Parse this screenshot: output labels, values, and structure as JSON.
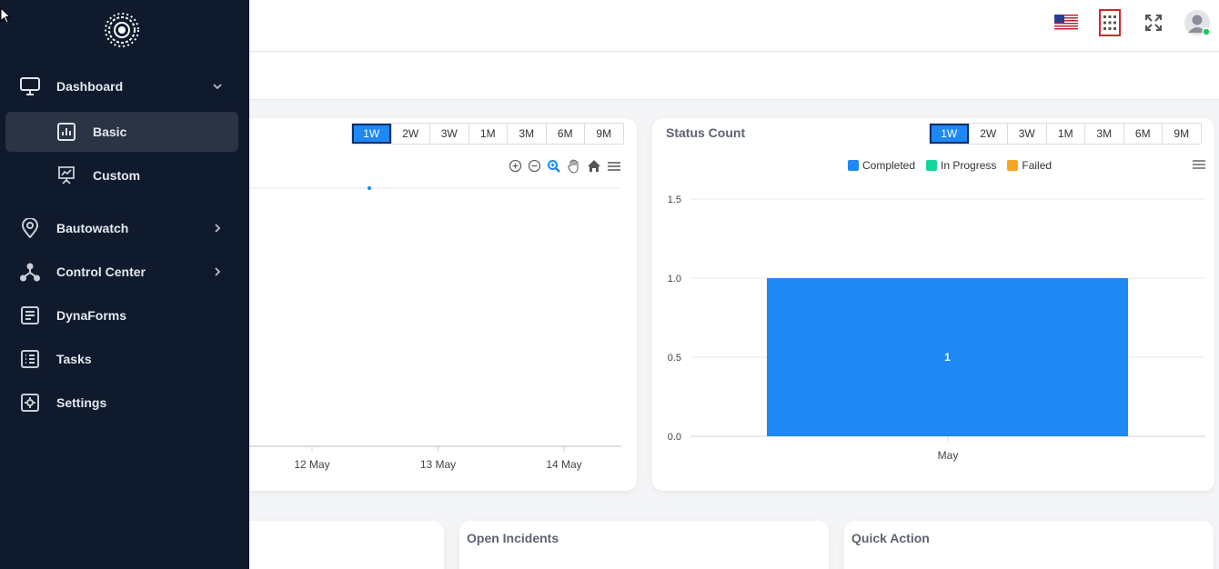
{
  "sidebar": {
    "items": [
      {
        "label": "Dashboard",
        "icon": "monitor-icon",
        "expanded": true
      },
      {
        "label": "Basic",
        "icon": "bar-chart-icon",
        "active": true
      },
      {
        "label": "Custom",
        "icon": "presentation-chart-icon"
      },
      {
        "label": "Bautowatch",
        "icon": "location-pin-icon",
        "has_children": true
      },
      {
        "label": "Control Center",
        "icon": "network-icon",
        "has_children": true
      },
      {
        "label": "DynaForms",
        "icon": "form-icon"
      },
      {
        "label": "Tasks",
        "icon": "task-list-icon"
      },
      {
        "label": "Settings",
        "icon": "settings-icon"
      }
    ]
  },
  "header": {
    "icons": [
      "us-flag-icon",
      "apps-grid-icon",
      "fullscreen-icon",
      "user-avatar-icon"
    ]
  },
  "left_chart": {
    "ranges": [
      "1W",
      "2W",
      "3W",
      "1M",
      "3M",
      "6M",
      "9M"
    ],
    "active_range": "1W",
    "toolbar": [
      "zoom-in-icon",
      "zoom-out-icon",
      "zoom-select-icon",
      "pan-icon",
      "home-icon",
      "menu-icon"
    ],
    "chart_data": {
      "type": "line",
      "x_ticks": [
        "12 May",
        "13 May",
        "14 May"
      ],
      "title": "",
      "xlabel": "",
      "ylabel": ""
    }
  },
  "status_count": {
    "title": "Status Count",
    "ranges": [
      "1W",
      "2W",
      "3W",
      "1M",
      "3M",
      "6M",
      "9M"
    ],
    "active_range": "1W",
    "legend": [
      {
        "name": "Completed",
        "color": "#1e88f5"
      },
      {
        "name": "In Progress",
        "color": "#14d69a"
      },
      {
        "name": "Failed",
        "color": "#f5a623"
      }
    ],
    "chart_data": {
      "type": "bar",
      "categories": [
        "May"
      ],
      "series": [
        {
          "name": "Completed",
          "values": [
            1
          ]
        },
        {
          "name": "In Progress",
          "values": [
            0
          ]
        },
        {
          "name": "Failed",
          "values": [
            0
          ]
        }
      ],
      "y_ticks": [
        "0.0",
        "0.5",
        "1.0",
        "1.5"
      ],
      "ylim": [
        0,
        1.5
      ],
      "data_label": "1",
      "grid": true,
      "legend_position": "top-center"
    }
  },
  "bottom_cards": {
    "open_incidents": "Open Incidents",
    "quick_action": "Quick Action"
  },
  "colors": {
    "sidebar_bg": "#0f1a2c",
    "accent": "#1e88f5"
  }
}
